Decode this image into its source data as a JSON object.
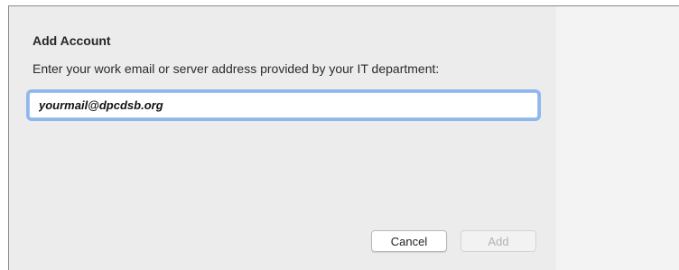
{
  "dialog": {
    "title": "Add Account",
    "instruction": "Enter your work email or server address provided by your IT department:",
    "email_value": "yourmail@dpcdsb.org",
    "cancel_label": "Cancel",
    "add_label": "Add",
    "add_enabled": false,
    "focus_ring_color": "#8db7ee"
  }
}
